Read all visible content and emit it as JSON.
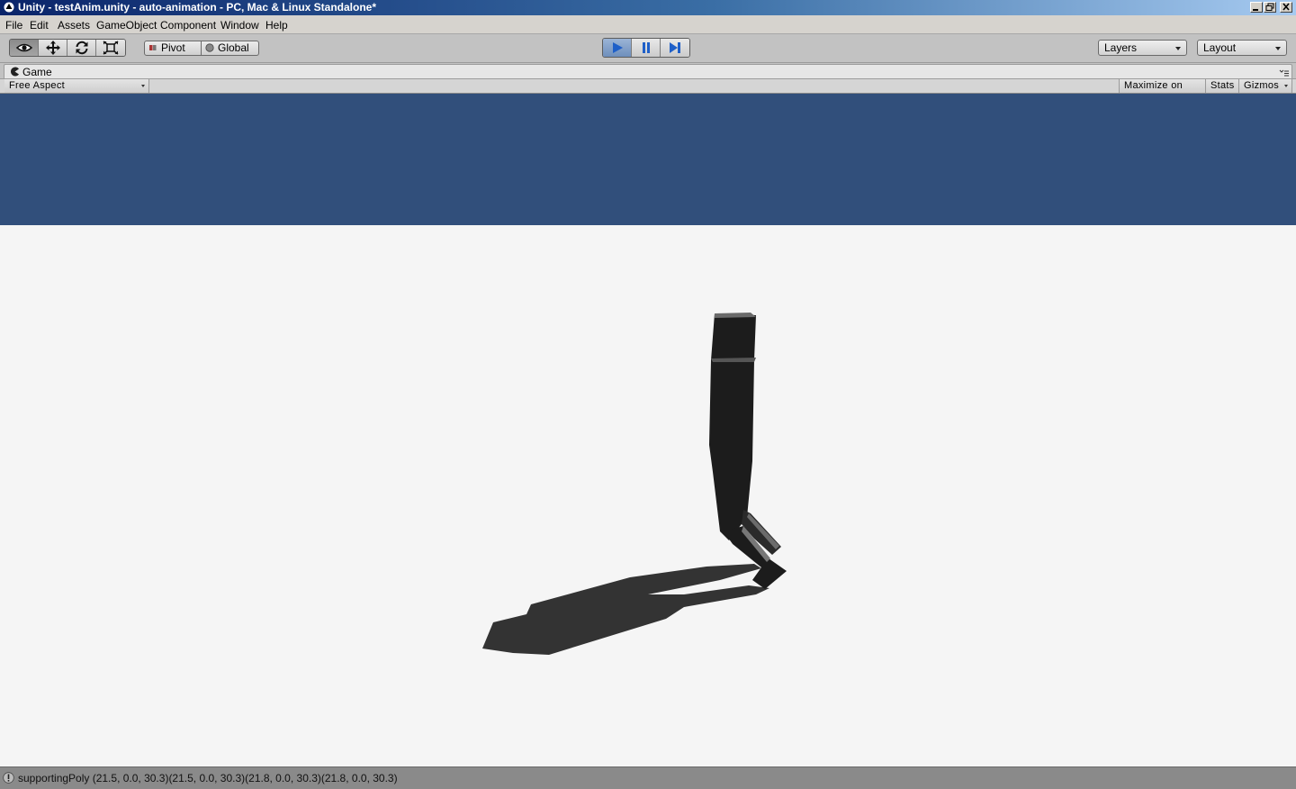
{
  "window": {
    "title": "Unity - testAnim.unity - auto-animation - PC, Mac & Linux Standalone*",
    "controls": [
      "minimize",
      "restore",
      "close"
    ]
  },
  "menu": {
    "items": [
      "File",
      "Edit",
      "Assets",
      "GameObject",
      "Component",
      "Window",
      "Help"
    ]
  },
  "toolbar": {
    "tools": [
      "view-tool",
      "move-tool",
      "rotate-tool",
      "scale-tool"
    ],
    "active_tool": "view-tool",
    "pivot_label": "Pivot",
    "global_label": "Global",
    "playback": [
      "play",
      "pause",
      "step"
    ],
    "play_active": true,
    "layers_label": "Layers",
    "layout_label": "Layout"
  },
  "game_view": {
    "tab_label": "Game",
    "aspect_label": "Free Aspect",
    "maximize_label": "Maximize on Play",
    "stats_label": "Stats",
    "gizmos_label": "Gizmos",
    "colors": {
      "sky": "#314f7b",
      "ground": "#f5f5f5",
      "character": "#1c1c1c",
      "shadow": "#333333"
    }
  },
  "status": {
    "message": "supportingPoly (21.5, 0.0, 30.3)(21.5, 0.0, 30.3)(21.8, 0.0, 30.3)(21.8, 0.0, 30.3)"
  }
}
